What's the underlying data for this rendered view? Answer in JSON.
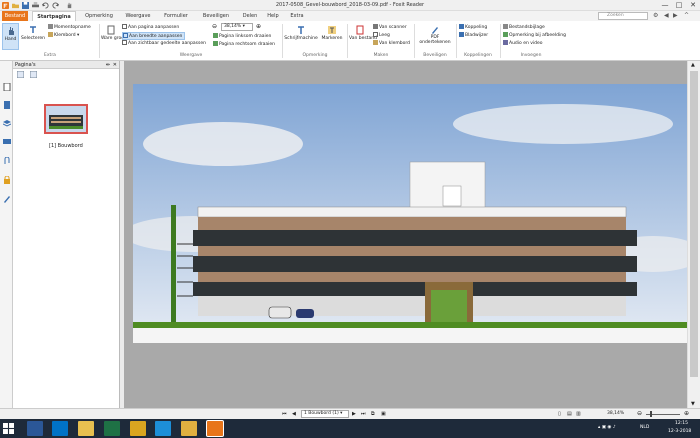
{
  "window": {
    "title": "2017-0508_Gevel-bouwbord_2018-03-09.pdf - Foxit Reader",
    "controls": [
      "—",
      "□",
      "✕"
    ]
  },
  "menu": {
    "file_tab": "Bestand",
    "tabs": [
      "Startpagina",
      "Opmerking",
      "Weergave",
      "Formulier",
      "Beveiligen",
      "Delen",
      "Help",
      "Extra"
    ],
    "active_tab": "Startpagina",
    "search_placeholder": "Zoeken"
  },
  "ribbon": {
    "hand": "Hand",
    "select": "Selecteren",
    "snapshot": "Momentopname",
    "clipboard": "Klembord",
    "actual_size": "Ware grootte",
    "fit_page": "Aan pagina aanpassen",
    "fit_width": "Aan breedte aanpassen",
    "fit_visible": "Aan zichtbaar gedeelte aanpassen",
    "zoom_value": "38,14%",
    "rotate_left": "Pagina linksom draaien",
    "rotate_right": "Pagina rechtsom draaien",
    "typewriter": "Schrijfmachine",
    "highlight": "Markeren",
    "from_file": "Van bestand",
    "from_scanner": "Van scanner",
    "blank": "Leeg",
    "from_clipboard": "Van klembord",
    "pdf_sign": "PDF ondertekenen",
    "link": "Koppeling",
    "bookmark": "Bladwijzer",
    "file_attach": "Bestandsbijlage",
    "image_annot": "Opmerking bij afbeelding",
    "audio_video": "Audio en video",
    "groups": {
      "extra": "Extra",
      "view": "Weergave",
      "comment": "Opmerking",
      "create": "Maken",
      "protect": "Beveiligen",
      "links": "Koppelingen",
      "insert": "Invoegen"
    }
  },
  "sidebar": {
    "panel_title": "Pagina's",
    "thumb_label": "[1] Bouwbord"
  },
  "status": {
    "page_selector": "1 Bouwbord (1)",
    "zoom": "38,14%"
  },
  "taskbar": {
    "lang": "NLD",
    "time": "12:15",
    "date": "12-3-2018"
  }
}
